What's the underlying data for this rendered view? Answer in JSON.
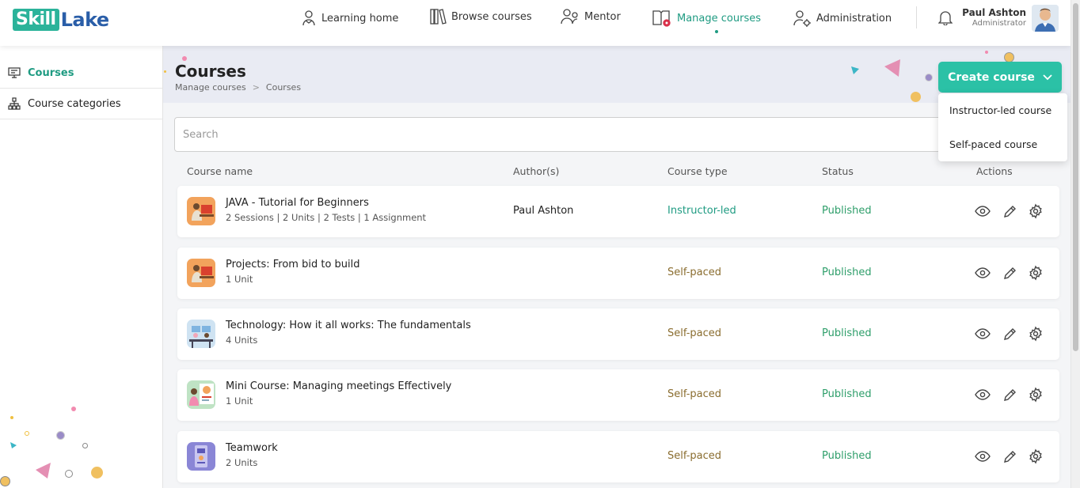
{
  "logo": {
    "part1": "Skill",
    "part2": "Lake"
  },
  "nav": [
    {
      "label": "Learning home",
      "icon": "learning-home-icon"
    },
    {
      "label": "Browse courses",
      "icon": "books-icon"
    },
    {
      "label": "Mentor",
      "icon": "mentor-icon"
    },
    {
      "label": "Manage courses",
      "icon": "manage-courses-icon",
      "active": true
    },
    {
      "label": "Administration",
      "icon": "administration-icon"
    }
  ],
  "user": {
    "name": "Paul Ashton",
    "role": "Administrator"
  },
  "sidebar": {
    "items": [
      {
        "label": "Courses",
        "active": true
      },
      {
        "label": "Course categories"
      }
    ]
  },
  "page": {
    "title": "Courses",
    "breadcrumb": [
      "Manage courses",
      "Courses"
    ]
  },
  "create_button": {
    "label": "Create course",
    "options": [
      "Instructor-led course",
      "Self-paced course"
    ]
  },
  "search": {
    "placeholder": "Search"
  },
  "table": {
    "columns": [
      "Course name",
      "Author(s)",
      "Course type",
      "Status",
      "Actions"
    ],
    "rows": [
      {
        "title": "JAVA - Tutorial for Beginners",
        "meta": "2 Sessions | 2 Units | 2 Tests | 1 Assignment",
        "author": "Paul Ashton",
        "type": "Instructor-led",
        "status": "Published"
      },
      {
        "title": "Projects: From bid to build",
        "meta": "1 Unit",
        "author": "",
        "type": "Self-paced",
        "status": "Published"
      },
      {
        "title": "Technology: How it all works: The fundamentals",
        "meta": "4 Units",
        "author": "",
        "type": "Self-paced",
        "status": "Published"
      },
      {
        "title": "Mini Course: Managing meetings Effectively",
        "meta": "1 Unit",
        "author": "",
        "type": "Self-paced",
        "status": "Published"
      },
      {
        "title": "Teamwork",
        "meta": "2 Units",
        "author": "",
        "type": "Self-paced",
        "status": "Published"
      }
    ]
  },
  "colors": {
    "accent": "#2bc1a6",
    "active_text": "#1f9b82",
    "header_bg": "#e9ebf3"
  }
}
